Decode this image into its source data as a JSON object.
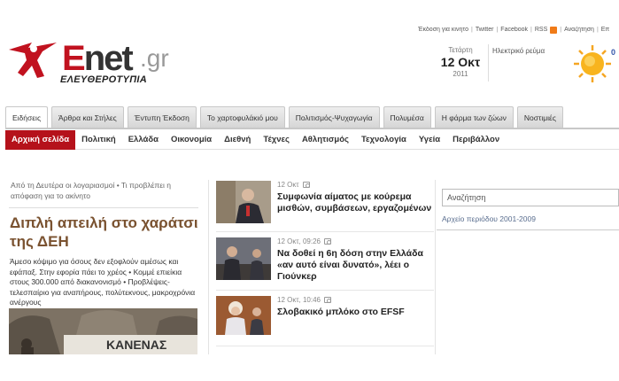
{
  "top_links": [
    "Έκδοση για κινητό",
    "Twitter",
    "Facebook",
    "RSS",
    "Αναζήτηση",
    "Επ"
  ],
  "logo": {
    "word_e": "E",
    "word_rest": "net",
    "tld": ".gr",
    "subtitle": "ΕΛΕΥΘΕΡΟΤΥΠΙΑ"
  },
  "date": {
    "weekday": "Τετάρτη",
    "day": "12 Οκτ",
    "year": "2011"
  },
  "weather": {
    "label": "Ηλεκτρικό ρεύμα",
    "value": "0"
  },
  "tabs": [
    {
      "label": "Ειδήσεις",
      "active": true
    },
    {
      "label": "Άρθρα και Στήλες",
      "active": false
    },
    {
      "label": "Έντυπη Έκδοση",
      "active": false
    },
    {
      "label": "Το χαρτοφυλάκιό μου",
      "active": false
    },
    {
      "label": "Πολιτισμός-Ψυχαγωγία",
      "active": false
    },
    {
      "label": "Πολυμέσα",
      "active": false
    },
    {
      "label": "Η φάρμα των ζώων",
      "active": false
    },
    {
      "label": "Νοστιμιές",
      "active": false
    }
  ],
  "categories": [
    {
      "label": "Αρχική σελίδα",
      "active": true
    },
    {
      "label": "Πολιτική",
      "active": false
    },
    {
      "label": "Ελλάδα",
      "active": false
    },
    {
      "label": "Οικονομία",
      "active": false
    },
    {
      "label": "Διεθνή",
      "active": false
    },
    {
      "label": "Τέχνες",
      "active": false
    },
    {
      "label": "Αθλητισμός",
      "active": false
    },
    {
      "label": "Τεχνολογία",
      "active": false
    },
    {
      "label": "Υγεία",
      "active": false
    },
    {
      "label": "Περιβάλλον",
      "active": false
    }
  ],
  "lead": {
    "teaser": "Από τη Δευτέρα οι λογαριασμοί • Τι προβλέπει η απόφαση για το ακίνητο",
    "title": "Διπλή απειλή στο χαράτσι της ΔΕΗ",
    "description": "Άμεσο κόψιμο για όσους δεν εξοφλούν αμέσως και εφάπαξ. Στην εφορία πάει το χρέος • Κομμέ επιείκια στους 300.000 από διακανονισμό • Προβλέψεις-τελεσπαίριο για αναπήρους, πολύτεκνους, μακροχρόνια ανέργους",
    "banner_text": "ΚΑΝΕΝΑΣ"
  },
  "news": [
    {
      "meta": "12 Οκτ",
      "headline": "Συμφωνία αίματος με κούρεμα μισθών, συμβάσεων, εργαζομένων"
    },
    {
      "meta": "12 Οκτ, 09:26",
      "headline": "Να δοθεί η 6η δόση στην Ελλάδα «αν αυτό είναι δυνατό», λέει ο Γιούνκερ"
    },
    {
      "meta": "12 Οκτ, 10:46",
      "headline": "Σλοβακικό μπλόκο στο EFSF"
    }
  ],
  "sidebar": {
    "search_value": "Αναζήτηση",
    "archive_label": "Αρχείο περιόδου 2001-2009"
  }
}
